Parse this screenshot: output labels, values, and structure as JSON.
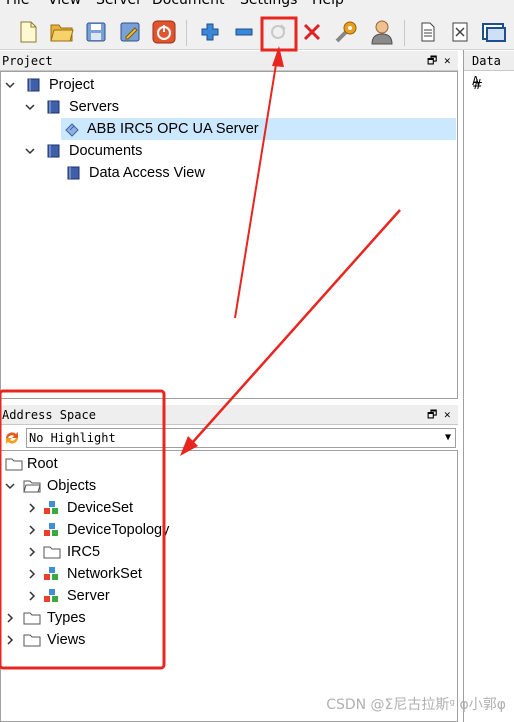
{
  "menu": [
    "File",
    "View",
    "Server",
    "Document",
    "Settings",
    "Help"
  ],
  "toolbar": {
    "icons": [
      "new-document-icon",
      "open-folder-icon",
      "save-icon",
      "edit-icon",
      "power-icon",
      "add-icon",
      "remove-icon",
      "connect-icon",
      "disconnect-icon",
      "settings-wrench-icon",
      "user-icon",
      "document-icon",
      "close-x-icon",
      "window-icon"
    ]
  },
  "project_panel": {
    "title": "Project",
    "float_ctl": "🗗",
    "close_ctl": "✕",
    "tree": {
      "project": "Project",
      "servers": "Servers",
      "server_item": "ABB IRC5 OPC UA Server",
      "documents": "Documents",
      "document_item": "Data Access View"
    }
  },
  "data_panel": {
    "title": "Data A",
    "col_hash": "#"
  },
  "address_panel": {
    "title": "Address Space",
    "float_ctl": "🗗",
    "close_ctl": "✕",
    "highlight": "No Highlight",
    "tree": {
      "root": "Root",
      "objects": "Objects",
      "deviceset": "DeviceSet",
      "devicetopology": "DeviceTopology",
      "irc5": "IRC5",
      "networkset": "NetworkSet",
      "server": "Server",
      "types": "Types",
      "views": "Views"
    }
  },
  "watermark": "CSDN @Σ尼古拉斯ᵍ  φ小郭φ",
  "colors": {
    "annotation_red": "#e8251e",
    "selection": "#cce8ff"
  }
}
